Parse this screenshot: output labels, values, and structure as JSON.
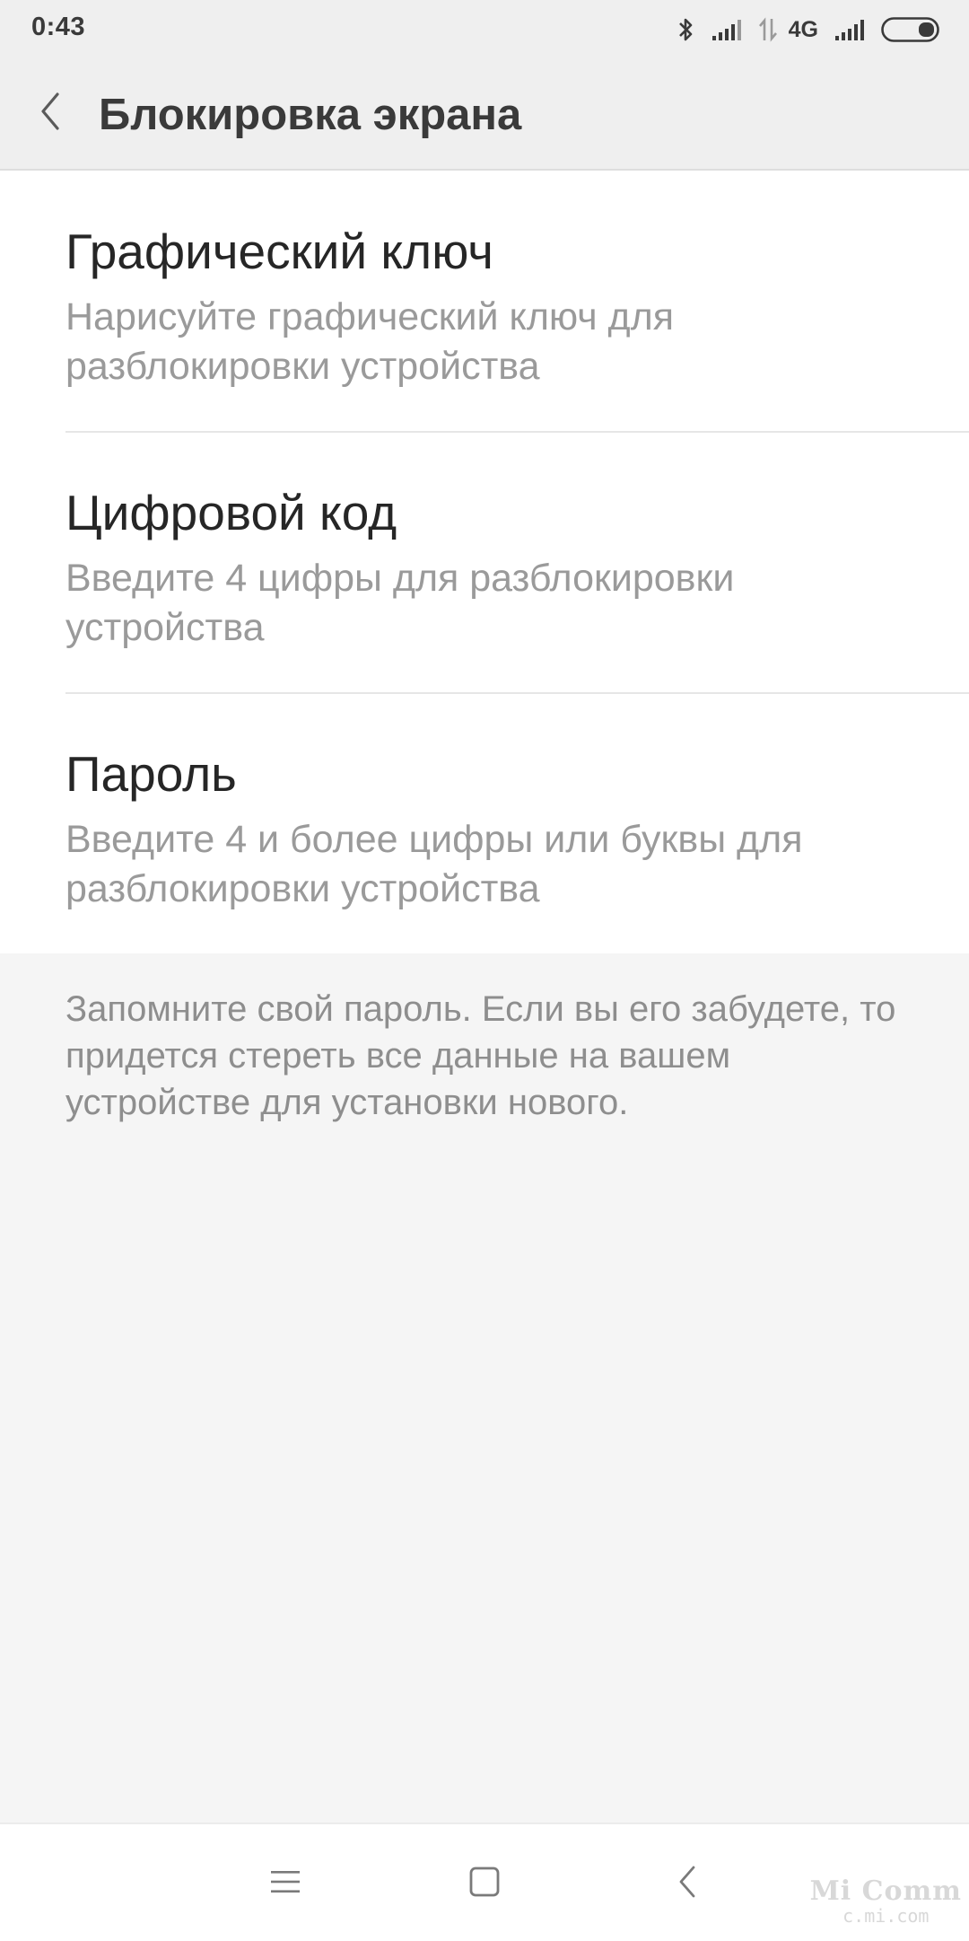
{
  "status_bar": {
    "time": "0:43",
    "network_type": "4G",
    "icons": [
      "bluetooth-icon",
      "signal-icon",
      "data-transfer-icon",
      "signal-icon",
      "battery-icon"
    ]
  },
  "header": {
    "back_icon": "chevron-left-icon",
    "title": "Блокировка экрана"
  },
  "options": [
    {
      "title": "Графический ключ",
      "description": "Нарисуйте графический ключ для разблокировки устройства"
    },
    {
      "title": "Цифровой код",
      "description": "Введите 4 цифры для разблокировки устройства"
    },
    {
      "title": "Пароль",
      "description": "Введите 4 и более цифры или буквы для разблокировки устройства"
    }
  ],
  "note": "Запомните свой пароль. Если вы его забудете, то придется стереть все данные на вашем устройстве для установки нового.",
  "navbar": {
    "icons": [
      "menu-icon",
      "home-icon",
      "back-icon"
    ]
  },
  "watermark": {
    "main": "Mi Comm",
    "sub": "c.mi.com"
  },
  "colors": {
    "background": "#f5f5f5",
    "header_background": "#efefef",
    "card_background": "#ffffff",
    "title_text": "#262626",
    "secondary_text": "#9a9a9a"
  }
}
